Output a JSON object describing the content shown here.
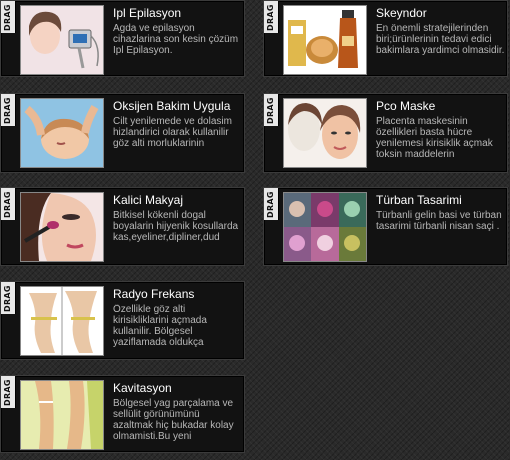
{
  "drag_label": "DRAG",
  "left_cards": [
    {
      "title": "Ipl Epilasyon",
      "desc": "Agda ve epilasyon cihazlarina son kesin çözüm Ipl Epilasyon.",
      "image": "ipl-device-photo"
    },
    {
      "title": "Oksijen Bakim Uygula",
      "desc": "Cilt yenilemede ve dolasim hizlandirici olarak kullanilir göz alti morluklarinin",
      "image": "oxygen-facial-photo"
    },
    {
      "title": "Kalici Makyaj",
      "desc": "Bitkisel kökenli dogal boyalarin hijyenik kosullarda kas,eyeliner,dipliner,dud",
      "image": "makeup-brush-photo"
    },
    {
      "title": "Radyo Frekans",
      "desc": "Özellikle göz alti kirisikliklarini açmada kullanilir. Bölgesel yaziflamada oldukça",
      "image": "waist-measure-photo"
    },
    {
      "title": "Kavitasyon",
      "desc": "Bölgesel yag parçalama ve sellülit görünümünü azaltmak hiç bukadar kolay olmamisti.Bu yeni",
      "image": "legs-photo"
    }
  ],
  "right_cards": [
    {
      "title": "Skeyndor",
      "desc": "En önemli stratejilerinden biri;ürünlerinin tedavi edici bakimlara yardimci olmasidir.",
      "image": "cosmetics-products-photo"
    },
    {
      "title": "Pco Maske",
      "desc": "Placenta maskesinin özellikleri basta hücre yenilemesi kirisiklik açmak toksin maddelerin",
      "image": "face-mask-photo"
    },
    {
      "title": "Türban Tasarimi",
      "desc": "Türbanli gelin basi ve türban tasarimi türbanli nisan saçi .",
      "image": "turban-collage-photo"
    }
  ]
}
